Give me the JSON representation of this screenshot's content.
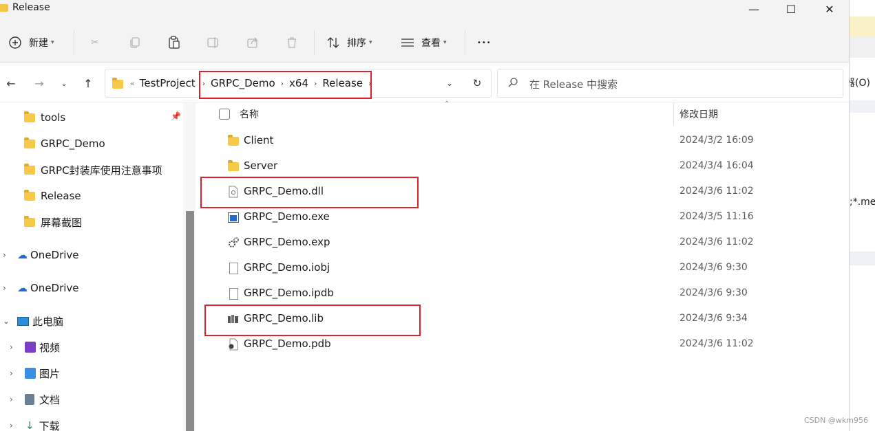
{
  "window": {
    "title": "Release",
    "minimize_glyph": "—",
    "maximize_glyph": "☐",
    "close_glyph": "✕"
  },
  "toolbar": {
    "new_label": "新建",
    "sort_label": "排序",
    "view_label": "查看",
    "more_glyph": "•••"
  },
  "address": {
    "crumbs": [
      "TestProject",
      "GRPC_Demo",
      "x64",
      "Release"
    ],
    "overflow_glyph": "«",
    "search_placeholder": "在 Release 中搜索"
  },
  "sidebar": {
    "quick_items": [
      {
        "label": "tools",
        "pinned": true
      },
      {
        "label": "GRPC_Demo"
      },
      {
        "label": "GRPC封装库使用注意事项"
      },
      {
        "label": "Release"
      },
      {
        "label": "屏幕截图"
      }
    ],
    "onedrive_1": "OneDrive",
    "onedrive_2": "OneDrive",
    "this_pc": "此电脑",
    "pc_items": [
      "视频",
      "图片",
      "文档",
      "下载"
    ]
  },
  "columns": {
    "name": "名称",
    "modified": "修改日期"
  },
  "files": [
    {
      "name": "Client",
      "date": "2024/3/2 16:09",
      "icon": "folder-icon"
    },
    {
      "name": "Server",
      "date": "2024/3/4 16:04",
      "icon": "folder-icon"
    },
    {
      "name": "GRPC_Demo.dll",
      "date": "2024/3/6 11:02",
      "icon": "dll-gear-icon"
    },
    {
      "name": "GRPC_Demo.exe",
      "date": "2024/3/5 11:16",
      "icon": "exe-window-icon"
    },
    {
      "name": "GRPC_Demo.exp",
      "date": "2024/3/6 11:02",
      "icon": "gears-icon"
    },
    {
      "name": "GRPC_Demo.iobj",
      "date": "2024/3/6 9:30",
      "icon": "blank-file-icon"
    },
    {
      "name": "GRPC_Demo.ipdb",
      "date": "2024/3/6 9:30",
      "icon": "blank-file-icon"
    },
    {
      "name": "GRPC_Demo.lib",
      "date": "2024/3/6 9:34",
      "icon": "library-icon"
    },
    {
      "name": "GRPC_Demo.pdb",
      "date": "2024/3/6 11:02",
      "icon": "debug-file-icon"
    }
  ],
  "background_window": {
    "text_1": "器(O)",
    "text_2": ";*.met"
  },
  "watermark": "CSDN @wkm956",
  "colors": {
    "highlight": "#e0202a",
    "folder": "#f7c948",
    "accent": "#1e6bd6"
  }
}
